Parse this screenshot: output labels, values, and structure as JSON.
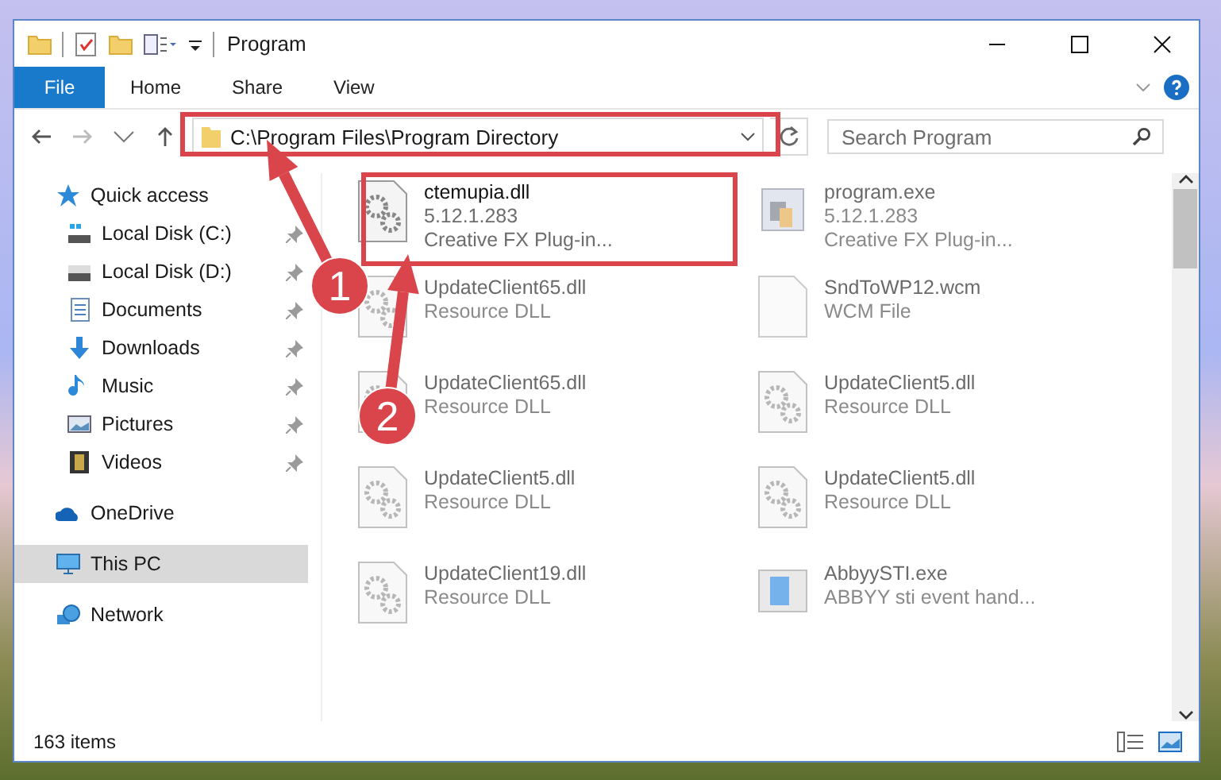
{
  "window": {
    "title": "Program"
  },
  "ribbon": {
    "tabs": [
      {
        "label": "File",
        "selected": true
      },
      {
        "label": "Home",
        "selected": false
      },
      {
        "label": "Share",
        "selected": false
      },
      {
        "label": "View",
        "selected": false
      }
    ]
  },
  "address": {
    "path": "C:\\Program Files\\Program Directory"
  },
  "search": {
    "placeholder": "Search Program"
  },
  "sidebar": {
    "items": [
      {
        "label": "Quick access",
        "selected": false,
        "children": [
          {
            "label": "Local Disk (C:)",
            "pinned": true
          },
          {
            "label": "Local Disk (D:)",
            "pinned": true
          },
          {
            "label": "Documents",
            "pinned": true
          },
          {
            "label": "Downloads",
            "pinned": true
          },
          {
            "label": "Music",
            "pinned": true
          },
          {
            "label": "Pictures",
            "pinned": true
          },
          {
            "label": "Videos",
            "pinned": true
          }
        ]
      },
      {
        "label": "OneDrive",
        "selected": false
      },
      {
        "label": "This PC",
        "selected": true
      },
      {
        "label": "Network",
        "selected": false
      }
    ]
  },
  "files": [
    {
      "kind": "dll",
      "name": "ctemupia.dll",
      "lines": [
        "5.12.1.283",
        "Creative FX Plug-in..."
      ],
      "dimmed": false
    },
    {
      "kind": "exe",
      "name": "program.exe",
      "lines": [
        "5.12.1.283",
        "Creative FX Plug-in..."
      ],
      "dimmed": true
    },
    {
      "kind": "dll",
      "name": "UpdateClient65.dll",
      "lines": [
        "Resource DLL"
      ],
      "dimmed": true
    },
    {
      "kind": "file",
      "name": "SndToWP12.wcm",
      "lines": [
        "WCM File"
      ],
      "dimmed": true
    },
    {
      "kind": "dll",
      "name": "UpdateClient65.dll",
      "lines": [
        "Resource DLL"
      ],
      "dimmed": true
    },
    {
      "kind": "dll",
      "name": "UpdateClient5.dll",
      "lines": [
        "Resource DLL"
      ],
      "dimmed": true
    },
    {
      "kind": "dll",
      "name": "UpdateClient5.dll",
      "lines": [
        "Resource DLL"
      ],
      "dimmed": true
    },
    {
      "kind": "dll",
      "name": "UpdateClient5.dll",
      "lines": [
        "Resource DLL"
      ],
      "dimmed": true
    },
    {
      "kind": "dll",
      "name": "UpdateClient19.dll",
      "lines": [
        "Resource DLL"
      ],
      "dimmed": true
    },
    {
      "kind": "app",
      "name": "AbbyySTI.exe",
      "lines": [
        "ABBYY sti event hand..."
      ],
      "dimmed": true
    }
  ],
  "status_bar": {
    "count": "163 items"
  },
  "annotations": [
    {
      "label": "1"
    },
    {
      "label": "2"
    }
  ]
}
